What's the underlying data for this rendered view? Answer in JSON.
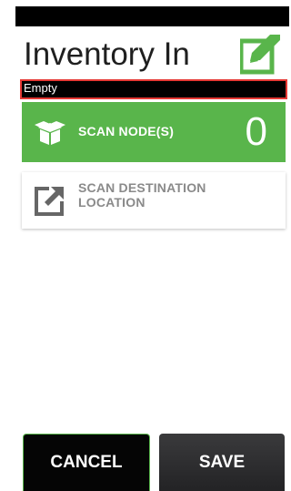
{
  "header": {
    "title": "Inventory In",
    "icon": "edit-check-icon",
    "icon_color": "#59b54b"
  },
  "status_field": {
    "value": "Empty",
    "border_color": "#e53935"
  },
  "cards": {
    "scan_nodes": {
      "label": "SCAN NODE(S)",
      "count": "0",
      "icon": "box-icon",
      "color": "#59b54b"
    },
    "scan_destination": {
      "label": "SCAN DESTINATION LOCATION",
      "icon": "external-link-icon"
    }
  },
  "buttons": {
    "cancel_label": "CANCEL",
    "save_label": "SAVE"
  }
}
